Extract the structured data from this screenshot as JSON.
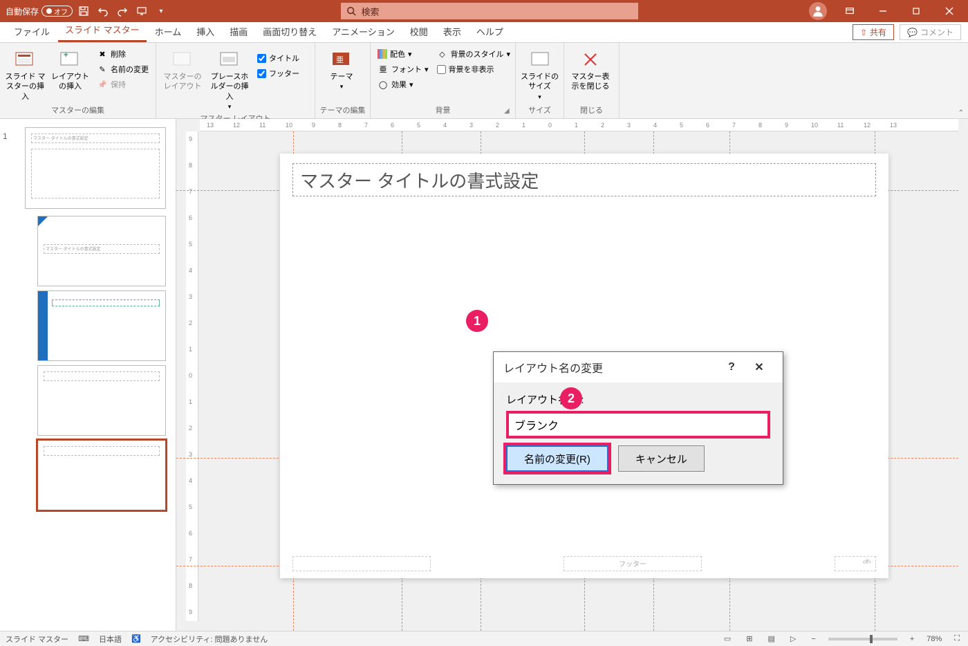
{
  "titlebar": {
    "autosave_label": "自動保存",
    "autosave_state": "オフ",
    "search_placeholder": "検索"
  },
  "window_controls": {
    "minimize": "最小化",
    "restore": "元に戻す",
    "close": "閉じる"
  },
  "tabs": {
    "file": "ファイル",
    "slide_master": "スライド マスター",
    "home": "ホーム",
    "insert": "挿入",
    "draw": "描画",
    "transitions": "画面切り替え",
    "animations": "アニメーション",
    "review": "校閲",
    "view": "表示",
    "help": "ヘルプ",
    "share": "共有",
    "comments": "コメント"
  },
  "ribbon": {
    "master_edit": {
      "insert_slide_master": "スライド マスターの挿入",
      "insert_layout": "レイアウトの挿入",
      "delete": "削除",
      "rename": "名前の変更",
      "preserve": "保持",
      "group_title": "マスターの編集"
    },
    "master_layout": {
      "master_layout_btn": "マスターのレイアウト",
      "insert_placeholder": "プレースホルダーの挿入",
      "title_chk": "タイトル",
      "footer_chk": "フッター",
      "group_title": "マスター レイアウト"
    },
    "theme_edit": {
      "themes": "テーマ",
      "group_title": "テーマの編集"
    },
    "background": {
      "colors": "配色",
      "fonts": "フォント",
      "effects": "効果",
      "bg_styles": "背景のスタイル",
      "hide_bg": "背景を非表示",
      "group_title": "背景"
    },
    "size": {
      "slide_size": "スライドのサイズ",
      "group_title": "サイズ"
    },
    "close": {
      "close_master": "マスター表示を閉じる",
      "group_title": "閉じる"
    }
  },
  "ruler_h_ticks": [
    "13",
    "12",
    "11",
    "10",
    "9",
    "8",
    "7",
    "6",
    "5",
    "4",
    "3",
    "2",
    "1",
    "0",
    "1",
    "2",
    "3",
    "4",
    "5",
    "6",
    "7",
    "8",
    "9",
    "10",
    "11",
    "12",
    "13"
  ],
  "ruler_v_ticks": [
    "9",
    "8",
    "7",
    "6",
    "5",
    "4",
    "3",
    "2",
    "1",
    "0",
    "1",
    "2",
    "3",
    "4",
    "5",
    "6",
    "7",
    "8",
    "9"
  ],
  "thumbnails": {
    "master_number": "1",
    "master_title_text": "マスター タイトルの書式設定"
  },
  "canvas": {
    "title_placeholder": "マスター タイトルの書式設定",
    "footer_center": "フッター",
    "footer_right": "‹#›"
  },
  "dialog": {
    "title": "レイアウト名の変更",
    "label": "レイアウト名(L):",
    "input_value": "ブランク",
    "rename_btn": "名前の変更(R)",
    "cancel_btn": "キャンセル",
    "help": "?",
    "close": "✕"
  },
  "callouts": {
    "one": "1",
    "two": "2"
  },
  "statusbar": {
    "view_label": "スライド マスター",
    "language": "日本語",
    "accessibility": "アクセシビリティ: 問題ありません",
    "zoom": "78%"
  }
}
